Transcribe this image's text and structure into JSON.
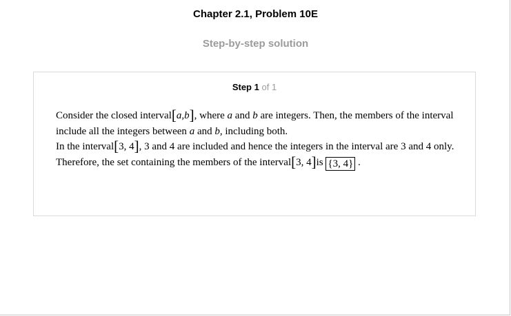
{
  "header": {
    "chapter_title": "Chapter 2.1, Problem 10E",
    "subtitle": "Step-by-step solution"
  },
  "step": {
    "label": "Step 1",
    "of_text": "of 1"
  },
  "content": {
    "p1_a": "Consider the closed interval",
    "p1_interval": "a,b",
    "p1_b": ", where",
    "p1_var_a": "a",
    "p1_c": "and",
    "p1_var_b": "b",
    "p1_d": "are integers. Then, the members of the interval include all the integers between",
    "p1_var_a2": "a",
    "p1_e": "and",
    "p1_var_b2": "b",
    "p1_f": ", including both.",
    "p2_a": "In the interval",
    "p2_interval": "3, 4",
    "p2_b": ", 3 and 4 are included and hence the integers in the interval are 3 and 4 only.",
    "p3_a": "Therefore, the set containing the members of the interval",
    "p3_interval": "3, 4",
    "p3_b": "is",
    "p3_answer": "3, 4",
    "p3_c": "."
  }
}
